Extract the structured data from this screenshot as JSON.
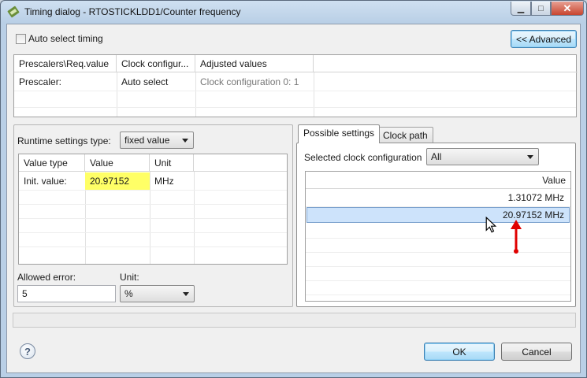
{
  "window": {
    "title": "Timing dialog - RTOSTICKLDD1/Counter frequency",
    "min_glyph": "▁",
    "max_glyph": "□",
    "close_glyph": "✕"
  },
  "top": {
    "auto_select_label": "Auto select timing",
    "advanced_button": "<< Advanced"
  },
  "prescaler_table": {
    "headers": [
      "Prescalers\\Req.value",
      "Clock configur...",
      "Adjusted values"
    ],
    "rows": [
      [
        "Prescaler:",
        "Auto select",
        "Clock configuration 0: 1"
      ]
    ]
  },
  "runtime": {
    "type_label": "Runtime settings type:",
    "type_value": "fixed value",
    "headers": [
      "Value type",
      "Value",
      "Unit"
    ],
    "row": {
      "type": "Init. value:",
      "value": "20.97152",
      "unit": "MHz"
    },
    "allowed_error_label": "Allowed error:",
    "allowed_error_value": "5",
    "unit_label": "Unit:",
    "unit_value": "%"
  },
  "tabs": {
    "possible": "Possible settings",
    "clock_path": "Clock path",
    "selected_label": "Selected clock configuration",
    "selected_value": "All",
    "value_header": "Value",
    "values": [
      "1.31072 MHz",
      "20.97152 MHz"
    ]
  },
  "footer": {
    "help_glyph": "?",
    "ok": "OK",
    "cancel": "Cancel"
  },
  "colors": {
    "highlight_yellow": "#ffff66",
    "selected_row": "#cde3fb",
    "annotation_arrow": "#e00000"
  }
}
